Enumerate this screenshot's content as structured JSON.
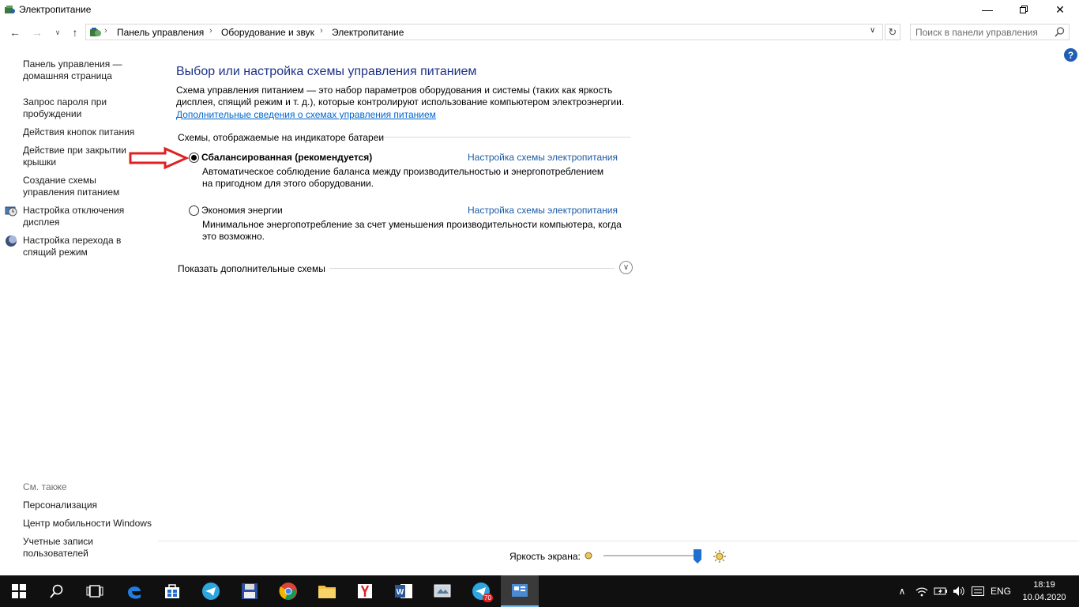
{
  "window": {
    "title": "Электропитание"
  },
  "navigation": {
    "breadcrumbs": [
      "Панель управления",
      "Оборудование и звук",
      "Электропитание"
    ],
    "search_placeholder": "Поиск в панели управления"
  },
  "sidebar": {
    "items": [
      {
        "label": "Панель управления — домашняя страница"
      },
      {
        "label": "Запрос пароля при пробуждении"
      },
      {
        "label": "Действия кнопок питания"
      },
      {
        "label": "Действие при закрытии крышки"
      },
      {
        "label": "Создание схемы управления питанием"
      },
      {
        "label": "Настройка отключения дисплея",
        "icon": "display-clock-icon"
      },
      {
        "label": "Настройка перехода в спящий режим",
        "icon": "moon-icon"
      }
    ],
    "see_also": {
      "heading": "См. также",
      "items": [
        "Персонализация",
        "Центр мобильности Windows",
        "Учетные записи пользователей"
      ]
    }
  },
  "main": {
    "title": "Выбор или настройка схемы управления питанием",
    "description": "Схема управления питанием — это набор параметров оборудования и системы (таких как яркость дисплея, спящий режим и т. д.), которые контролируют использование компьютером электроэнергии.",
    "more_link": "Дополнительные сведения о схемах управления питанием",
    "group_label": "Схемы, отображаемые на индикаторе батареи",
    "plans": [
      {
        "name": "Сбалансированная (рекомендуется)",
        "selected": true,
        "link": "Настройка схемы электропитания",
        "description": "Автоматическое соблюдение баланса между производительностью и энергопотреблением на пригодном для этого оборудовании."
      },
      {
        "name": "Экономия энергии",
        "selected": false,
        "link": "Настройка схемы электропитания",
        "description": "Минимальное энергопотребление за счет уменьшения производительности компьютера, когда это возможно."
      }
    ],
    "show_more": "Показать дополнительные схемы",
    "annotation": {
      "type": "red-arrow",
      "color": "#e02020"
    }
  },
  "brightness": {
    "label": "Яркость экрана:",
    "level_percent": 96
  },
  "taskbar": {
    "pinned": [
      "start-icon",
      "search-icon",
      "task-view-icon",
      "edge-icon",
      "store-icon",
      "telegram-icon",
      "floppy-save-icon",
      "chrome-icon",
      "file-explorer-icon",
      "yandex-icon",
      "word-icon",
      "app-window-icon",
      "telegram-icon",
      "control-panel-icon"
    ],
    "telegram_badge": "70",
    "language": "ENG",
    "time": "18:19",
    "date": "10.04.2020"
  },
  "colors": {
    "title_blue": "#1e3287",
    "link_blue": "#1a5ba6",
    "taskbar": "#101010",
    "slider_thumb": "#1e6fd0"
  }
}
